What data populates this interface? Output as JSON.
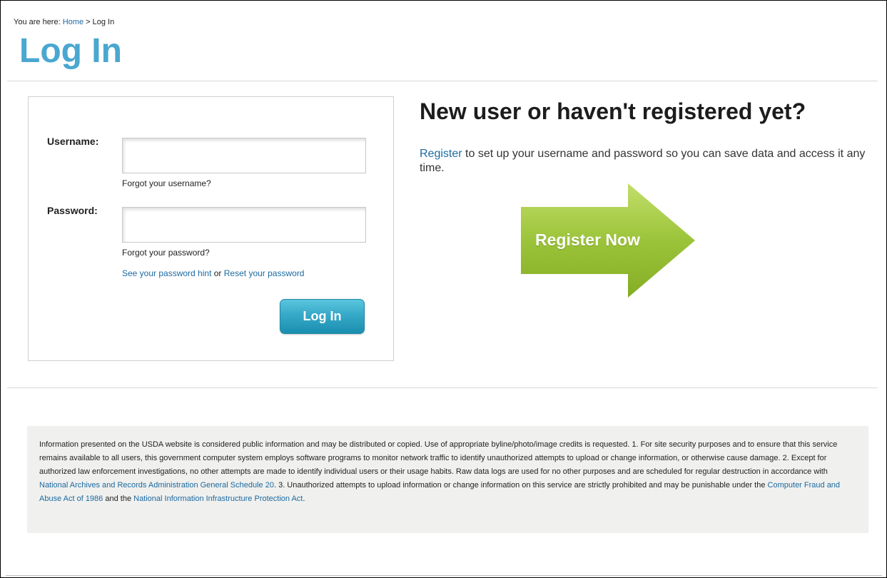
{
  "breadcrumb": {
    "prefix": "You are here:",
    "home_label": "Home",
    "separator": ">",
    "current": "Log In"
  },
  "page_title": "Log In",
  "login_form": {
    "username_label": "Username:",
    "username_value": "",
    "forgot_username": "Forgot your username?",
    "password_label": "Password:",
    "password_value": "",
    "forgot_password": "Forgot your password?",
    "password_hint_link": "See your password hint",
    "or_text": "or",
    "reset_password_link": "Reset your password",
    "login_button": "Log In"
  },
  "register": {
    "title": "New user or haven't registered yet?",
    "link": "Register",
    "text": "to set up your username and password so you can save data and access it any time.",
    "arrow_label": "Register Now",
    "arrow_color": "#9cc43a"
  },
  "disclaimer": {
    "text1": "Information presented on the USDA website is considered public information and may be distributed or copied. Use of appropriate byline/photo/image credits is requested. 1. For site security purposes and to ensure that this service remains available to all users, this government computer system employs software programs to monitor network traffic to identify unauthorized attempts to upload or change information, or otherwise cause damage. 2. Except for authorized law enforcement investigations, no other attempts are made to identify individual users or their usage habits. Raw data logs are used for no other purposes and are scheduled for regular destruction in accordance with",
    "link1": "National Archives and Records Administration General Schedule 20",
    "text2": ". 3. Unauthorized attempts to upload information or change information on this service are strictly prohibited and may be punishable under the",
    "link2": "Computer Fraud and Abuse Act of 1986",
    "text3": "and the",
    "link3": "National Information Infrastructure Protection Act",
    "text4": "."
  },
  "colors": {
    "title_blue": "#4aa7d0",
    "link_blue": "#1b6aa1",
    "button_teal": "#36a9c8",
    "disclaimer_bg": "#f0f0ee"
  }
}
